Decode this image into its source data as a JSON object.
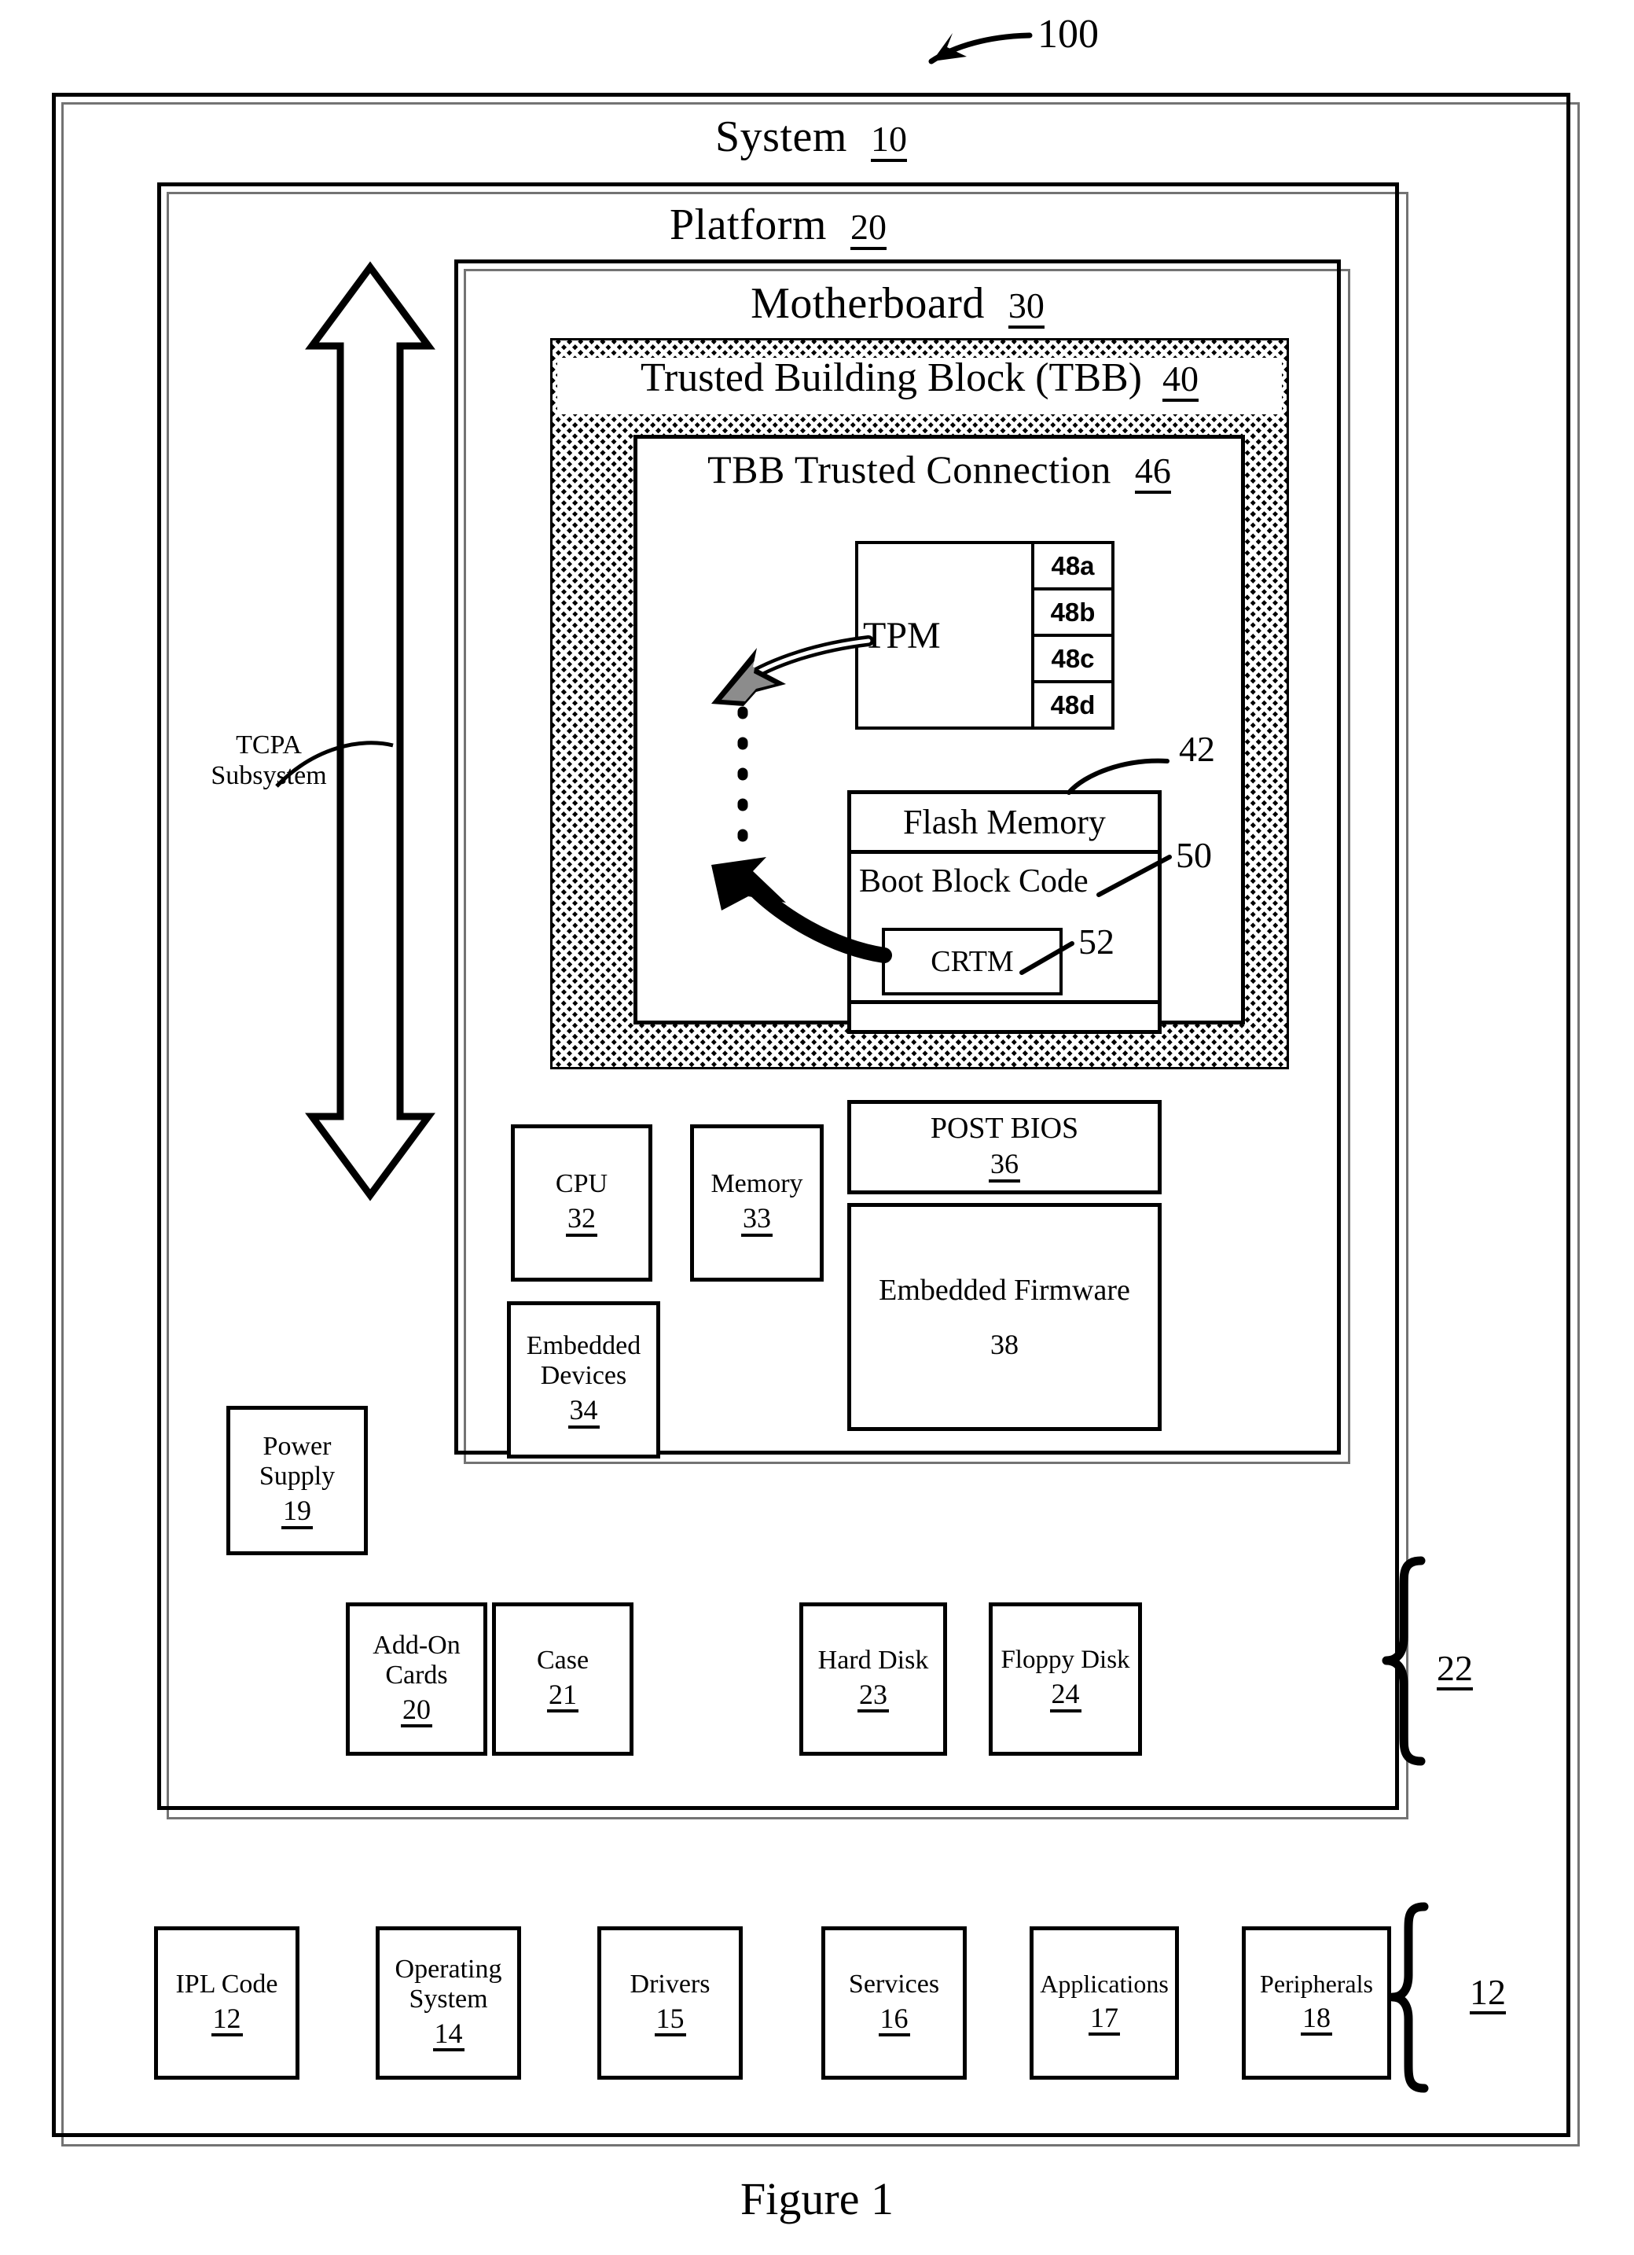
{
  "figure": {
    "caption": "Figure 1",
    "callout_100": "100"
  },
  "frames": {
    "system": {
      "label": "System",
      "number": "10"
    },
    "platform": {
      "label": "Platform",
      "number": "20"
    },
    "motherboard": {
      "label": "Motherboard",
      "number": "30"
    },
    "tbb": {
      "label": "Trusted Building Block (TBB)",
      "number": "40"
    },
    "tbb_connection": {
      "label": "TBB Trusted Connection",
      "number": "46"
    }
  },
  "tpm": {
    "label": "TPM",
    "registers": [
      "48a",
      "48b",
      "48c",
      "48d"
    ]
  },
  "flash": {
    "callout": "42",
    "title": "Flash Memory",
    "boot_block": "Boot Block Code",
    "boot_block_callout": "50",
    "crtm": "CRTM",
    "crtm_callout": "52"
  },
  "tcpa": {
    "line1": "TCPA",
    "line2": "Subsystem"
  },
  "motherboard_components": [
    {
      "label": "CPU",
      "number": "32",
      "underline": true
    },
    {
      "label": "Memory",
      "number": "33",
      "underline": true
    },
    {
      "label": "POST BIOS",
      "number": "36",
      "underline": true
    },
    {
      "label": "Embedded\nDevices",
      "number": "34",
      "underline": true
    },
    {
      "label": "Embedded Firmware",
      "number": "38",
      "underline": false
    }
  ],
  "platform_components": {
    "power_supply": {
      "label": "Power\nSupply",
      "number": "19"
    },
    "brace_number": "22",
    "items": [
      {
        "label": "Add-On\nCards",
        "number": "20"
      },
      {
        "label": "Case",
        "number": "21"
      },
      {
        "label": "Hard Disk",
        "number": "23"
      },
      {
        "label": "Floppy Disk",
        "number": "24"
      }
    ]
  },
  "system_components": {
    "brace_number": "12",
    "items": [
      {
        "label": "IPL Code",
        "number": "12"
      },
      {
        "label": "Operating\nSystem",
        "number": "14"
      },
      {
        "label": "Drivers",
        "number": "15"
      },
      {
        "label": "Services",
        "number": "16"
      },
      {
        "label": "Applications",
        "number": "17"
      },
      {
        "label": "Peripherals",
        "number": "18"
      }
    ]
  }
}
